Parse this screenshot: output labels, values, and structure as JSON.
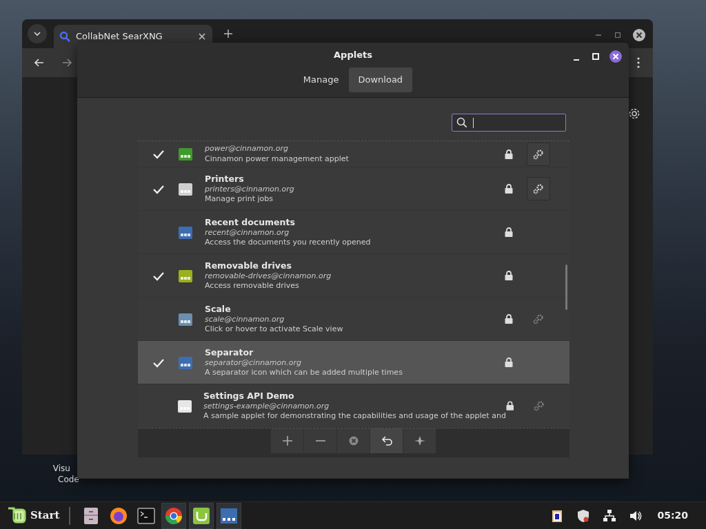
{
  "browser": {
    "tab_title": "CollabNet SearXNG"
  },
  "desktop_icon": {
    "label_lines": [
      "Visu",
      "Code"
    ]
  },
  "dialog": {
    "title": "Applets",
    "tabs": [
      {
        "label": "Manage",
        "selected": false
      },
      {
        "label": "Download",
        "selected": true
      }
    ],
    "applets": [
      {
        "kind": "configurable",
        "uuid": "power@cinnamon.org",
        "description": "Cinnamon power management applet",
        "enabled": true,
        "selected": false
      },
      {
        "kind": "configurable",
        "name": "Printers",
        "uuid": "printers@cinnamon.org",
        "description": "Manage print jobs",
        "enabled": true,
        "selected": false
      },
      {
        "kind": "plain",
        "name": "Recent documents",
        "uuid": "recent@cinnamon.org",
        "description": "Access the documents you recently opened",
        "enabled": false,
        "selected": false
      },
      {
        "kind": "plain",
        "name": "Removable drives",
        "uuid": "removable-drives@cinnamon.org",
        "description": "Access removable drives",
        "enabled": true,
        "selected": false
      },
      {
        "kind": "unconfigurable",
        "name": "Scale",
        "uuid": "scale@cinnamon.org",
        "description": "Click or hover to activate Scale view",
        "enabled": false,
        "selected": false
      },
      {
        "kind": "plain",
        "name": "Separator",
        "uuid": "separator@cinnamon.org",
        "description": "A separator icon which can be added multiple times",
        "enabled": true,
        "selected": true
      },
      {
        "kind": "unconfigurable",
        "name": "Settings API Demo",
        "uuid": "settings-example@cinnamon.org",
        "description": "A sample applet for demonstrating the capabilities and usage of the applet and",
        "enabled": false,
        "selected": false
      }
    ]
  },
  "taskbar": {
    "start_label": "Start",
    "apps": [
      {
        "running": false
      },
      {
        "running": false
      },
      {
        "running": false
      },
      {
        "running": true
      },
      {
        "running": true
      },
      {
        "running": true
      }
    ],
    "clock": "05:20"
  }
}
